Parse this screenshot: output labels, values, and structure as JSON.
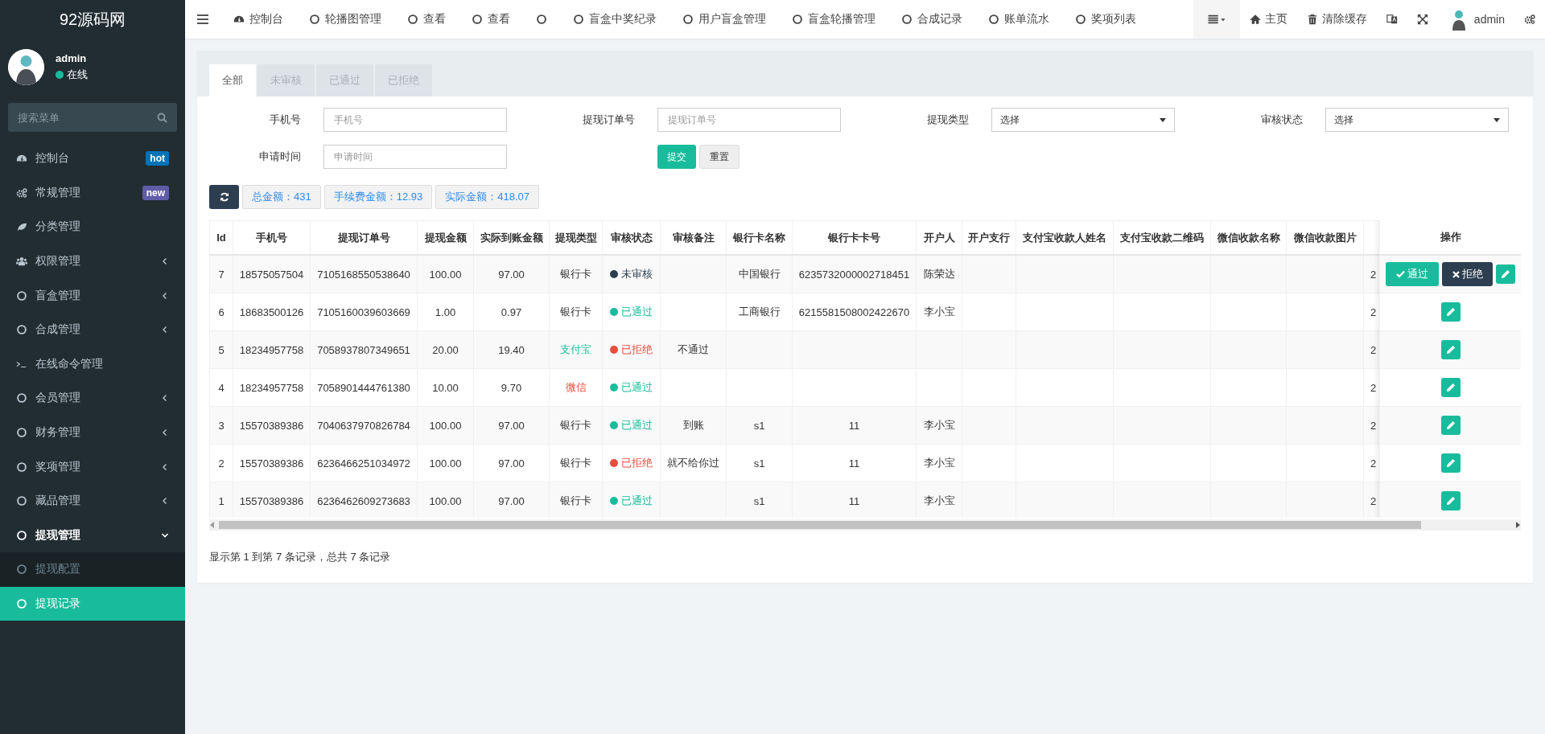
{
  "sidebar": {
    "brand": "92源码网",
    "user": {
      "name": "admin",
      "status": "在线",
      "online": true
    },
    "search": {
      "placeholder": "搜索菜单"
    },
    "items": [
      {
        "kind": "dashboard",
        "label": "控制台",
        "badge": {
          "text": "hot",
          "color": "#0073b7"
        },
        "selected": false
      },
      {
        "kind": "gears",
        "label": "常规管理",
        "badge": {
          "text": "new",
          "color": "#605ca8"
        },
        "selected": false
      },
      {
        "kind": "leaf",
        "label": "分类管理",
        "selected": false
      },
      {
        "kind": "users",
        "label": "权限管理",
        "expanded": false,
        "selected": false
      },
      {
        "kind": "circle",
        "label": "盲盒管理",
        "expanded": false,
        "selected": false
      },
      {
        "kind": "circle",
        "label": "合成管理",
        "expanded": false,
        "selected": false
      },
      {
        "kind": "terminal",
        "label": "在线命令管理",
        "selected": false
      },
      {
        "kind": "circle",
        "label": "会员管理",
        "expanded": false,
        "selected": false
      },
      {
        "kind": "circle",
        "label": "财务管理",
        "expanded": false,
        "selected": false
      },
      {
        "kind": "circle",
        "label": "奖项管理",
        "expanded": false,
        "selected": false
      },
      {
        "kind": "circle",
        "label": "藏品管理",
        "expanded": false,
        "selected": false
      },
      {
        "kind": "circle",
        "label": "提现管理",
        "expanded": true,
        "selected": false,
        "children": [
          {
            "label": "提现配置",
            "selected": false
          },
          {
            "label": "提现记录",
            "selected": true
          }
        ]
      }
    ]
  },
  "topbar": {
    "nav": [
      {
        "kind": "dashboard",
        "label": "控制台"
      },
      {
        "kind": "circle",
        "label": "轮播图管理"
      },
      {
        "kind": "circle",
        "label": "查看"
      },
      {
        "kind": "circle",
        "label": "查看"
      },
      {
        "kind": "circle"
      },
      {
        "kind": "circle",
        "label": "盲盒中奖纪录"
      },
      {
        "kind": "circle",
        "label": "用户盲盒管理"
      },
      {
        "kind": "circle",
        "label": "盲盒轮播管理"
      },
      {
        "kind": "circle",
        "label": "合成记录"
      },
      {
        "kind": "circle",
        "label": "账单流水"
      },
      {
        "kind": "circle",
        "label": "奖项列表"
      }
    ],
    "actions": [
      {
        "kind": "list-caret"
      },
      {
        "kind": "home",
        "label": "主页"
      },
      {
        "kind": "trash",
        "label": "清除缓存"
      },
      {
        "kind": "translate"
      },
      {
        "kind": "expand"
      },
      {
        "kind": "avatar",
        "label": "admin"
      },
      {
        "kind": "gears"
      }
    ]
  },
  "tabs": [
    {
      "label": "全部",
      "selected": true
    },
    {
      "label": "未审核",
      "selected": false
    },
    {
      "label": "已通过",
      "selected": false
    },
    {
      "label": "已拒绝",
      "selected": false
    }
  ],
  "filters": [
    {
      "kind": "text",
      "label": "手机号",
      "placeholder": "手机号"
    },
    {
      "kind": "text",
      "label": "提现订单号",
      "placeholder": "提现订单号"
    },
    {
      "kind": "select",
      "label": "提现类型",
      "value": "选择"
    },
    {
      "kind": "select",
      "label": "审核状态",
      "value": "选择"
    },
    {
      "kind": "text",
      "label": "申请时间",
      "placeholder": "申请时间"
    }
  ],
  "filter_buttons": {
    "submit": "提交",
    "reset": "重置"
  },
  "summary": [
    "总金额：431",
    "手续费金额：12.93",
    "实际金额：418.07"
  ],
  "table": {
    "columns": [
      "Id",
      "手机号",
      "提现订单号",
      "提现金额",
      "实际到账金额",
      "提现类型",
      "审核状态",
      "审核备注",
      "银行卡名称",
      "银行卡卡号",
      "开户人",
      "开户支行",
      "支付宝收款人姓名",
      "支付宝收款二维码",
      "微信收款名称",
      "微信收款图片"
    ],
    "actions_header": "操作",
    "approve_label": "通过",
    "reject_label": "拒绝",
    "rows": [
      {
        "id": "7",
        "phone": "18575057504",
        "order_no": "7105168550538640",
        "amount": "100.00",
        "actual": "97.00",
        "type": {
          "text": "银行卡",
          "kind": "bank"
        },
        "status": {
          "text": "未审核",
          "color": "#2c3e50"
        },
        "bank": "中国银行",
        "card": "6235732000002718451",
        "holder": "陈荣达",
        "column_17": "2",
        "kind": "review"
      },
      {
        "id": "6",
        "phone": "18683500126",
        "order_no": "7105160039603669",
        "amount": "1.00",
        "actual": "0.97",
        "type": {
          "text": "银行卡",
          "kind": "bank"
        },
        "status": {
          "text": "已通过",
          "color": "#18bc9c"
        },
        "bank": "工商银行",
        "card": "6215581508002422670",
        "holder": "李小宝",
        "column_17": "2",
        "kind": "edit"
      },
      {
        "id": "5",
        "phone": "18234957758",
        "order_no": "7058937807349651",
        "amount": "20.00",
        "actual": "19.40",
        "type": {
          "text": "支付宝",
          "kind": "alipay"
        },
        "status": {
          "text": "已拒绝",
          "color": "#e74c3c"
        },
        "remark": "不通过",
        "column_17": "2",
        "kind": "edit"
      },
      {
        "id": "4",
        "phone": "18234957758",
        "order_no": "7058901444761380",
        "amount": "10.00",
        "actual": "9.70",
        "type": {
          "text": "微信",
          "kind": "wechat"
        },
        "status": {
          "text": "已通过",
          "color": "#18bc9c"
        },
        "column_17": "2",
        "kind": "edit"
      },
      {
        "id": "3",
        "phone": "15570389386",
        "order_no": "7040637970826784",
        "amount": "100.00",
        "actual": "97.00",
        "type": {
          "text": "银行卡",
          "kind": "bank"
        },
        "status": {
          "text": "已通过",
          "color": "#18bc9c"
        },
        "remark": "到账",
        "bank": "s1",
        "card": "11",
        "holder": "李小宝",
        "column_17": "2",
        "kind": "edit"
      },
      {
        "id": "2",
        "phone": "15570389386",
        "order_no": "6236466251034972",
        "amount": "100.00",
        "actual": "97.00",
        "type": {
          "text": "银行卡",
          "kind": "bank"
        },
        "status": {
          "text": "已拒绝",
          "color": "#e74c3c"
        },
        "remark": "就不给你过",
        "bank": "s1",
        "card": "11",
        "holder": "李小宝",
        "column_17": "2",
        "kind": "edit"
      },
      {
        "id": "1",
        "phone": "15570389386",
        "order_no": "6236462609273683",
        "amount": "100.00",
        "actual": "97.00",
        "type": {
          "text": "银行卡",
          "kind": "bank"
        },
        "status": {
          "text": "已通过",
          "color": "#18bc9c"
        },
        "bank": "s1",
        "card": "11",
        "holder": "李小宝",
        "column_17": "2",
        "kind": "edit"
      }
    ]
  },
  "footer": "显示第 1 到第 7 条记录，总共 7 条记录"
}
